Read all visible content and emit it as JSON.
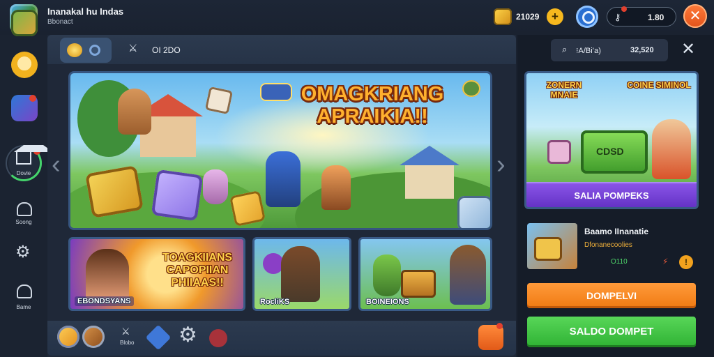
{
  "app": {
    "title": "Inanakal hu Indas",
    "subtitle": "Bbonact"
  },
  "header": {
    "coins": "21029",
    "coin_add": "+",
    "keys": "1.80",
    "close": "✕"
  },
  "sidebar": {
    "items": [
      {
        "icon": "map-icon"
      },
      {
        "icon": "smile-icon"
      },
      {
        "icon": "shield-icon"
      },
      {
        "icon": "home-icon",
        "label": "Dovie"
      },
      {
        "icon": "house-outline-icon",
        "label": "Soong"
      },
      {
        "icon": "gear-icon"
      },
      {
        "icon": "home-icon",
        "label": "Bame"
      }
    ]
  },
  "tabs": {
    "tab2_label": "OI 2DO"
  },
  "hero": {
    "title": "OMAGKRIANG APRAIKIA!!"
  },
  "cards": [
    {
      "title": "TOAGKIIANS CAPOPIIAN PHIIAAS!!",
      "label": "EBONDSYANS"
    },
    {
      "label": "RocliKS"
    },
    {
      "label": "BOINEIONS"
    }
  ],
  "dock": {
    "label3": "Blobo"
  },
  "right_panel": {
    "search_text": "⁝A/Bi’a)",
    "search_count": "32,520",
    "close": "✕",
    "promo": {
      "title_left": "ZONERN MNAIE",
      "title_right": "COINE SIMINOL",
      "chest_label": "CDSD",
      "button": "SALIA POMPEKS"
    },
    "offer": {
      "title": "Baamo IInanatie",
      "subtitle": "Dfonanecoolies",
      "price": "O110",
      "info": "!"
    },
    "btn_orange": "DOMPELVI",
    "btn_green": "SALDO DOMPET"
  },
  "colors": {
    "accent_orange": "#f07a12",
    "accent_green": "#2fb234",
    "accent_purple": "#6432c6",
    "background": "#1a2230"
  }
}
